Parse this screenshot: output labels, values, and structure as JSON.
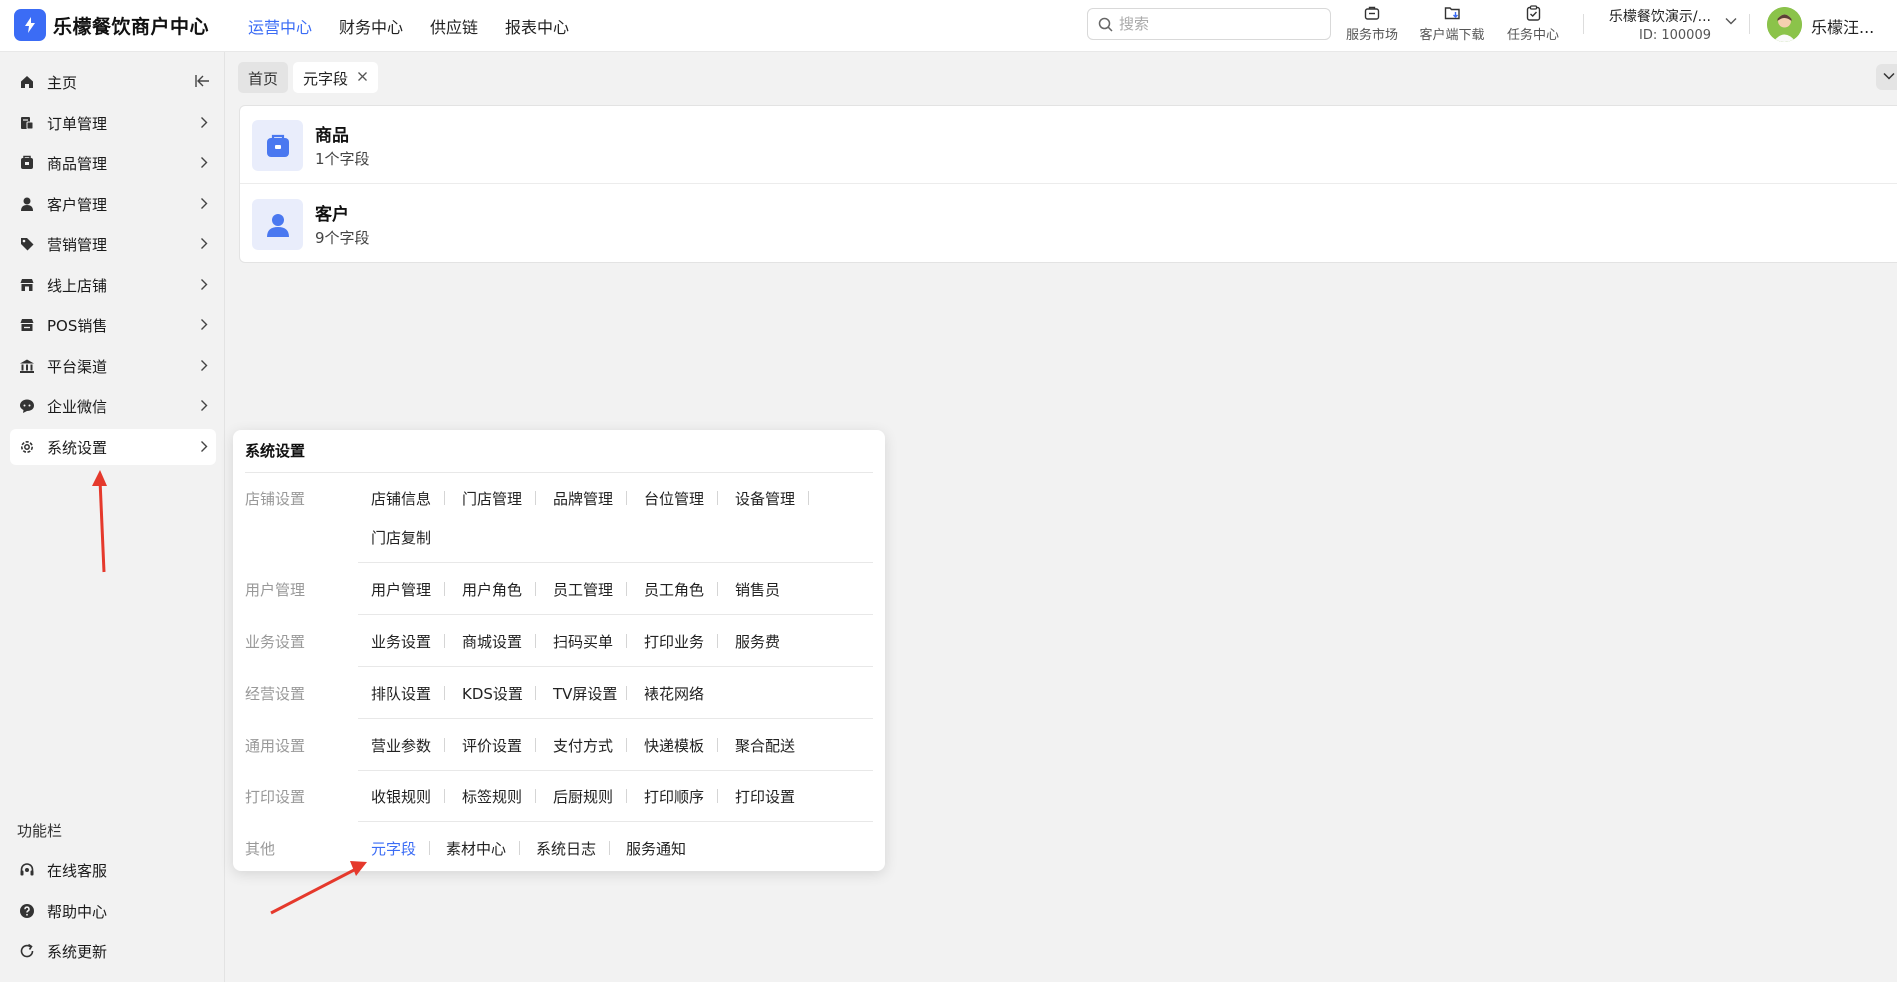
{
  "header": {
    "brand": "乐檬餐饮商户中心",
    "nav": [
      "运营中心",
      "财务中心",
      "供应链",
      "报表中心"
    ],
    "search_placeholder": "搜索",
    "tools": [
      "服务市场",
      "客户端下载",
      "任务中心"
    ],
    "store_name": "乐檬餐饮演示/...",
    "store_id": "ID: 100009",
    "username": "乐檬汪..."
  },
  "sidebar": {
    "items": [
      {
        "label": "主页",
        "icon": "home-icon"
      },
      {
        "label": "订单管理",
        "icon": "order-icon"
      },
      {
        "label": "商品管理",
        "icon": "goods-icon"
      },
      {
        "label": "客户管理",
        "icon": "user-icon"
      },
      {
        "label": "营销管理",
        "icon": "tag-icon"
      },
      {
        "label": "线上店铺",
        "icon": "shop-icon"
      },
      {
        "label": "POS销售",
        "icon": "pos-icon"
      },
      {
        "label": "平台渠道",
        "icon": "bank-icon"
      },
      {
        "label": "企业微信",
        "icon": "chat-icon"
      },
      {
        "label": "系统设置",
        "icon": "gear-icon"
      }
    ],
    "section_title": "功能栏",
    "bottom_items": [
      {
        "label": "在线客服",
        "icon": "headset-icon"
      },
      {
        "label": "帮助中心",
        "icon": "help-icon"
      },
      {
        "label": "系统更新",
        "icon": "refresh-icon"
      }
    ]
  },
  "tabs": {
    "home": "首页",
    "current": "元字段"
  },
  "cards": [
    {
      "title": "商品",
      "subtitle": "1个字段"
    },
    {
      "title": "客户",
      "subtitle": "9个字段"
    }
  ],
  "popup": {
    "title": "系统设置",
    "groups": [
      {
        "title": "店铺设置",
        "links": [
          "店铺信息",
          "门店管理",
          "品牌管理",
          "台位管理",
          "设备管理",
          "门店复制"
        ]
      },
      {
        "title": "用户管理",
        "links": [
          "用户管理",
          "用户角色",
          "员工管理",
          "员工角色",
          "销售员"
        ]
      },
      {
        "title": "业务设置",
        "links": [
          "业务设置",
          "商城设置",
          "扫码买单",
          "打印业务",
          "服务费"
        ]
      },
      {
        "title": "经营设置",
        "links": [
          "排队设置",
          "KDS设置",
          "TV屏设置",
          "裱花网络"
        ]
      },
      {
        "title": "通用设置",
        "links": [
          "营业参数",
          "评价设置",
          "支付方式",
          "快递模板",
          "聚合配送"
        ]
      },
      {
        "title": "打印设置",
        "links": [
          "收银规则",
          "标签规则",
          "后厨规则",
          "打印顺序",
          "打印设置"
        ]
      },
      {
        "title": "其他",
        "links": [
          "元字段",
          "素材中心",
          "系统日志",
          "服务通知"
        ]
      }
    ]
  },
  "colors": {
    "accent": "#3b6cf5",
    "annotation": "#e5392c"
  }
}
